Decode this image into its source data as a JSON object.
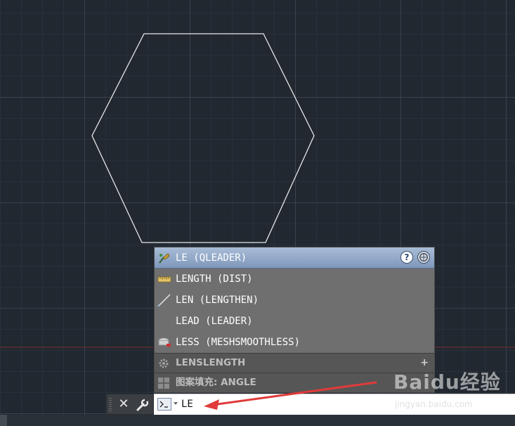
{
  "autocomplete": {
    "items": [
      {
        "label": "LE (QLEADER)",
        "icon": "qleader-icon",
        "selected": true
      },
      {
        "label": "LENGTH (DIST)",
        "icon": "ruler-icon"
      },
      {
        "label": "LEN (LENGTHEN)",
        "icon": "lengthen-line-icon"
      },
      {
        "label": "LEAD (LEADER)",
        "icon": ""
      },
      {
        "label": "LESS (MESHSMOOTHLESS)",
        "icon": "mesh-smooth-less-icon"
      }
    ],
    "help_label": "?",
    "sections": [
      {
        "label": "LENSLENGTH",
        "icon": "gear-icon",
        "expand": "+"
      },
      {
        "label": "图案填充: ANGLE",
        "icon": "hatch-pattern-icon"
      }
    ]
  },
  "command_line": {
    "close_label": "✕",
    "value": "LE"
  },
  "watermark": {
    "logo": "Baidu经验",
    "url": "jingyan.baidu.com"
  },
  "colors": {
    "canvas_bg": "#212830",
    "accent_selected": "#8ea6c6",
    "arrow": "#e03a3a"
  }
}
